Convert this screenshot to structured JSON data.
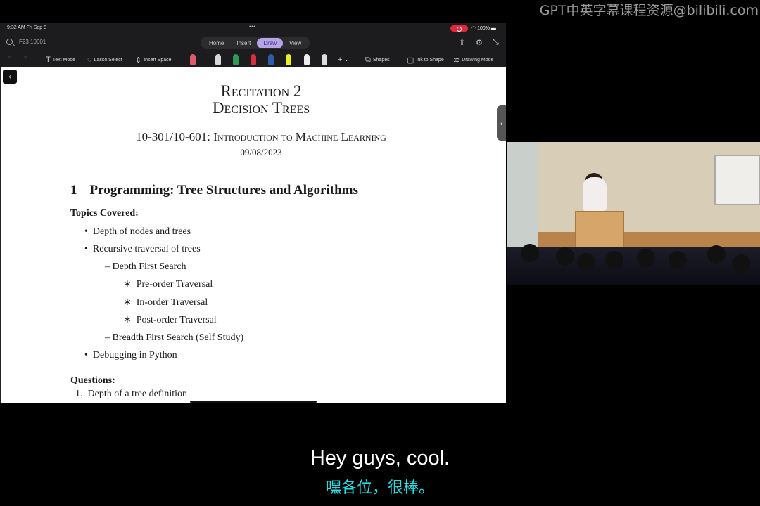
{
  "watermark": "GPT中英字幕课程资源@bilibili.com",
  "status": {
    "time": "9:32 AM  Fri Sep 8",
    "battery": "100%"
  },
  "search": {
    "notebook": "F23 10601"
  },
  "tabs": [
    {
      "label": "Home"
    },
    {
      "label": "Insert"
    },
    {
      "label": "Draw",
      "active": true
    },
    {
      "label": "View"
    }
  ],
  "toolbar": {
    "text_mode": "Text Mode",
    "lasso_select": "Lasso Select",
    "insert_space": "Insert Space",
    "shapes": "Shapes",
    "ink_to_shape": "Ink to Shape",
    "drawing_mode": "Drawing Mode"
  },
  "pens": [
    "#e05a6a",
    "#d8d8d8",
    "#2e9a52",
    "#d63040",
    "#2a5ea8",
    "#e8f020",
    "#222222",
    "#dddddd"
  ],
  "document": {
    "title1": "Recitation 2",
    "title2": "Decision Trees",
    "course": "10-301/10-601: Introduction to Machine Learning",
    "date": "09/08/2023",
    "section_num": "1",
    "section_title": "Programming: Tree Structures and Algorithms",
    "topics_heading": "Topics Covered:",
    "topics": [
      {
        "level": 1,
        "marker": "•",
        "text": "Depth of nodes and trees"
      },
      {
        "level": 1,
        "marker": "•",
        "text": "Recursive traversal of trees"
      },
      {
        "level": 2,
        "marker": "–",
        "text": "Depth First Search"
      },
      {
        "level": 3,
        "marker": "∗",
        "text": "Pre-order Traversal"
      },
      {
        "level": 3,
        "marker": "∗",
        "text": "In-order Traversal"
      },
      {
        "level": 3,
        "marker": "∗",
        "text": "Post-order Traversal"
      },
      {
        "level": 2,
        "marker": "–",
        "text": "Breadth First Search (Self Study)"
      },
      {
        "level": 1,
        "marker": "•",
        "text": "Debugging in Python"
      }
    ],
    "questions_heading": "Questions:",
    "question1": "1.  Depth of a tree definition"
  },
  "subtitles": {
    "en": "Hey guys, cool.",
    "zh": "嘿各位，很棒。"
  }
}
